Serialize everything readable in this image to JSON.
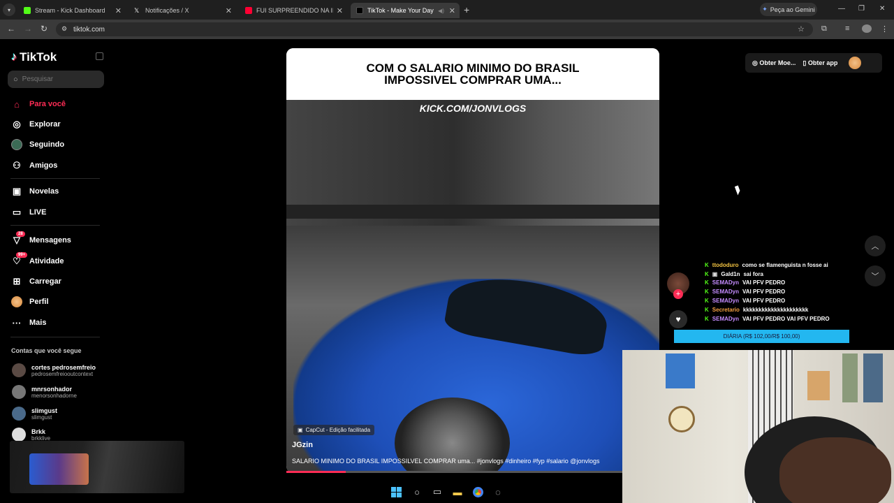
{
  "browser": {
    "tabs": [
      {
        "title": "Stream - Kick Dashboard",
        "color": "#53fc18"
      },
      {
        "title": "Notificações / X",
        "color": "#ffffff"
      },
      {
        "title": "FUI SURPREENDIDO NA ILHA !",
        "color": "#ff0033"
      },
      {
        "title": "TikTok - Make Your Day",
        "color": "#ffffff"
      }
    ],
    "gemini_label": "Peça ao Gemini",
    "url": "tiktok.com"
  },
  "tiktok": {
    "logo": "TikTok",
    "search_placeholder": "Pesquisar",
    "nav": [
      {
        "label": "Para você",
        "icon": "home-icon"
      },
      {
        "label": "Explorar",
        "icon": "compass-icon"
      },
      {
        "label": "Seguindo",
        "icon": "following-avatar"
      },
      {
        "label": "Amigos",
        "icon": "friends-icon"
      },
      {
        "label": "Novelas",
        "icon": "novelas-icon"
      },
      {
        "label": "LIVE",
        "icon": "live-icon"
      },
      {
        "label": "Mensagens",
        "icon": "messages-icon",
        "badge": "28"
      },
      {
        "label": "Atividade",
        "icon": "activity-icon",
        "badge": "99+"
      },
      {
        "label": "Carregar",
        "icon": "upload-icon"
      },
      {
        "label": "Perfil",
        "icon": "profile-avatar"
      },
      {
        "label": "Mais",
        "icon": "more-icon"
      }
    ],
    "following_title": "Contas que você segue",
    "following": [
      {
        "name": "cortes pedrosemfreio",
        "handle": "pedrosemfreiooutcontext"
      },
      {
        "name": "mnrsonhador",
        "handle": "menorsonhadorne"
      },
      {
        "name": "slimgust",
        "handle": "slimgust"
      },
      {
        "name": "Brkk",
        "handle": "brkklive"
      }
    ],
    "top_actions": {
      "coins": "Obter Moe...",
      "app": "Obter app"
    },
    "video": {
      "caption_line1": "COM O SALARIO MINIMO DO BRASIL",
      "caption_line2": "IMPOSSIVEL COMPRAR UMA...",
      "watermark": "KICK.COM/JONVLOGS",
      "capcut": "CapCut - Edição facilitada",
      "author": "JGzin",
      "description": "SALARIO MINIMO DO BRASIL IMPOSSILVEL COMPRAR uma... #jonvlogs #dinheiro #fyp #salario @jonvlogs",
      "progress": 0.16
    }
  },
  "stream_overlay": {
    "chat": [
      {
        "user": "ttododuro",
        "msg": "como se flamenguista n fosse ai",
        "user_color": "#f5c542"
      },
      {
        "user": "Gald1n",
        "msg": "sai fora",
        "user_color": "#ffffff"
      },
      {
        "user": "SEMADyn",
        "msg": "VAI PFV PEDRO",
        "user_color": "#c58cff"
      },
      {
        "user": "SEMADyn",
        "msg": "VAI PFV PEDRO",
        "user_color": "#c58cff"
      },
      {
        "user": "SEMADyn",
        "msg": "VAI PFV PEDRO",
        "user_color": "#c58cff"
      },
      {
        "user": "Secretario",
        "msg": "kkkkkkkkkkkkkkkkkkkkk",
        "user_color": "#f5a142"
      },
      {
        "user": "SEMADyn",
        "msg": "VAI PFV PEDRO VAI PFV PEDRO",
        "user_color": "#c58cff"
      }
    ],
    "goal_bar": "DIÁRIA (R$ 102,00/R$ 100,00)"
  }
}
